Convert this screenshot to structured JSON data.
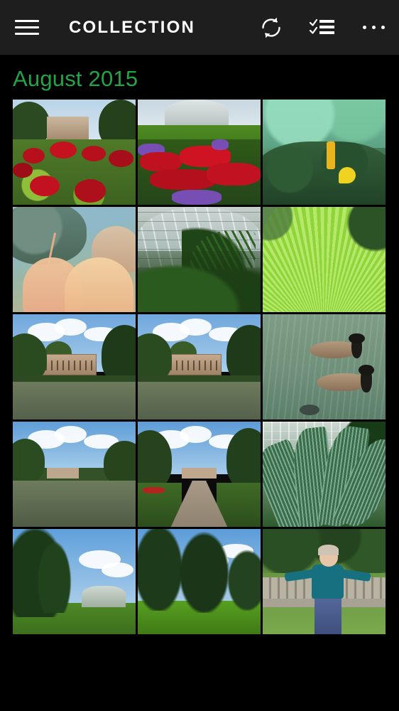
{
  "app": {
    "title": "COLLECTION",
    "background_color": "#000000",
    "appbar_color": "#1e1e1e",
    "accent_color": "#21a548"
  },
  "appbar": {
    "menu_icon": "hamburger-menu-icon",
    "title": "COLLECTION",
    "actions": [
      {
        "name": "refresh-button",
        "icon": "refresh-sync-icon"
      },
      {
        "name": "select-button",
        "icon": "checklist-icon"
      },
      {
        "name": "more-button",
        "icon": "ellipsis-icon"
      }
    ]
  },
  "groups": [
    {
      "title": "August 2015",
      "photos": [
        {
          "alt": "Red flowers in front of a stately house",
          "scene": "s1"
        },
        {
          "alt": "Formal red and purple flower beds by a glasshouse",
          "scene": "s2"
        },
        {
          "alt": "Green hedge with yellow flowers",
          "scene": "s3"
        },
        {
          "alt": "Pink coral and underwater plants",
          "scene": "s4"
        },
        {
          "alt": "Glasshouse interior with palms",
          "scene": "s5"
        },
        {
          "alt": "Large green fan palm leaf",
          "scene": "s6"
        },
        {
          "alt": "Palace across the lake",
          "scene": "s7"
        },
        {
          "alt": "Palace across the lake, second shot",
          "scene": "s8"
        },
        {
          "alt": "Two Canada geese swimming",
          "scene": "s9"
        },
        {
          "alt": "Wide view of the lake and palace",
          "scene": "s10"
        },
        {
          "alt": "Gravel path leading to the palace",
          "scene": "s11"
        },
        {
          "alt": "Cycad fronds in the glasshouse",
          "scene": "s12"
        },
        {
          "alt": "Conifers with glasshouse behind",
          "scene": "s13"
        },
        {
          "alt": "Large trees on the lawn",
          "scene": "s14"
        },
        {
          "alt": "Man in a teal sweater on a wooden bench",
          "scene": "s15"
        }
      ]
    }
  ]
}
